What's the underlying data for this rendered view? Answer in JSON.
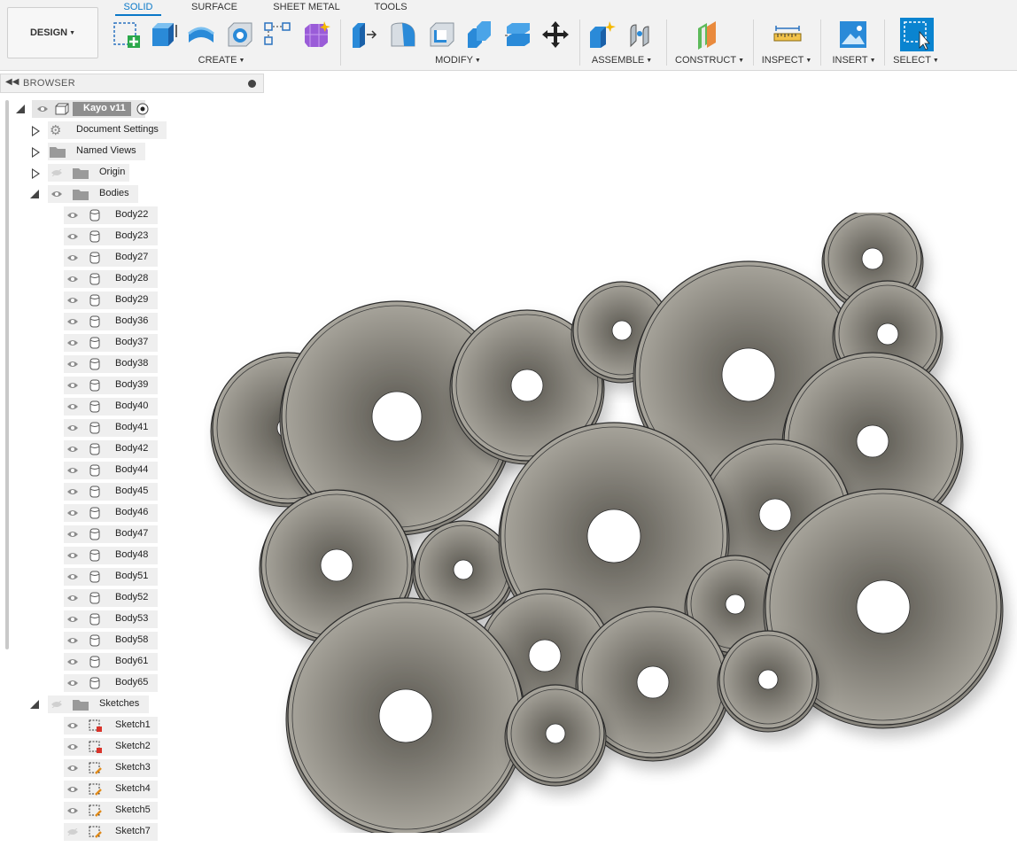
{
  "toolbar": {
    "design_label": "DESIGN",
    "tabs": [
      {
        "label": "SOLID",
        "active": true
      },
      {
        "label": "SURFACE",
        "active": false
      },
      {
        "label": "SHEET METAL",
        "active": false
      },
      {
        "label": "TOOLS",
        "active": false
      }
    ],
    "groups": [
      "CREATE",
      "MODIFY",
      "ASSEMBLE",
      "CONSTRUCT",
      "INSPECT",
      "INSERT",
      "SELECT"
    ],
    "accent_color": "#0a78c8"
  },
  "browser": {
    "title": "BROWSER",
    "root": {
      "label": "Kayo v11"
    },
    "folders": [
      "Document Settings",
      "Named Views",
      "Origin",
      "Bodies",
      "Sketches"
    ],
    "bodies": [
      "Body22",
      "Body23",
      "Body27",
      "Body28",
      "Body29",
      "Body36",
      "Body37",
      "Body38",
      "Body39",
      "Body40",
      "Body41",
      "Body42",
      "Body44",
      "Body45",
      "Body46",
      "Body47",
      "Body48",
      "Body51",
      "Body52",
      "Body53",
      "Body58",
      "Body61",
      "Body65"
    ],
    "sketches": [
      "Sketch1",
      "Sketch2",
      "Sketch3",
      "Sketch4",
      "Sketch5",
      "Sketch7"
    ]
  }
}
